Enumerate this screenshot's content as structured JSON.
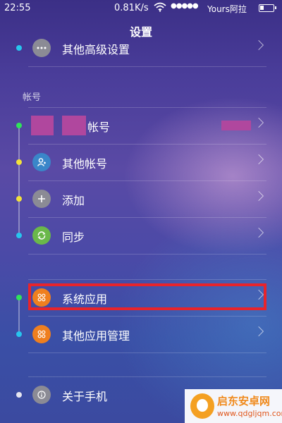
{
  "status": {
    "time": "22:55",
    "speed": "0.81K/s",
    "signal_dots": "●●●●●",
    "carrier": "Yours阿拉",
    "battery_level": 0.3
  },
  "header": {
    "title": "设置"
  },
  "top_item": {
    "label": "其他高级设置",
    "icon": "more-dots-icon"
  },
  "accounts_section": {
    "title": "帐号",
    "items": [
      {
        "label": "帐号",
        "icon": "account-avatar"
      },
      {
        "label": "其他帐号",
        "icon": "user-icon"
      },
      {
        "label": "添加",
        "icon": "plus-icon"
      },
      {
        "label": "同步",
        "icon": "sync-icon"
      }
    ]
  },
  "apps_section": {
    "items": [
      {
        "label": "系统应用",
        "icon": "apps-grid-icon"
      },
      {
        "label": "其他应用管理",
        "icon": "apps-grid-icon"
      }
    ]
  },
  "about_item": {
    "label": "关于手机",
    "icon": "info-icon"
  },
  "watermark": {
    "line1": "启东安卓网",
    "line2": "www.qdgljqm.com"
  },
  "colors": {
    "dot_green": "#2fe35a",
    "dot_yellow": "#f3e23a",
    "dot_cyan": "#27c6ee",
    "dot_white": "#e6e6f0",
    "icon_gray": "#8b8b95",
    "icon_blue": "#3a86c9",
    "icon_green": "#6ab84a",
    "icon_orange": "#ef7f1f",
    "highlight_red": "#e8242b"
  }
}
